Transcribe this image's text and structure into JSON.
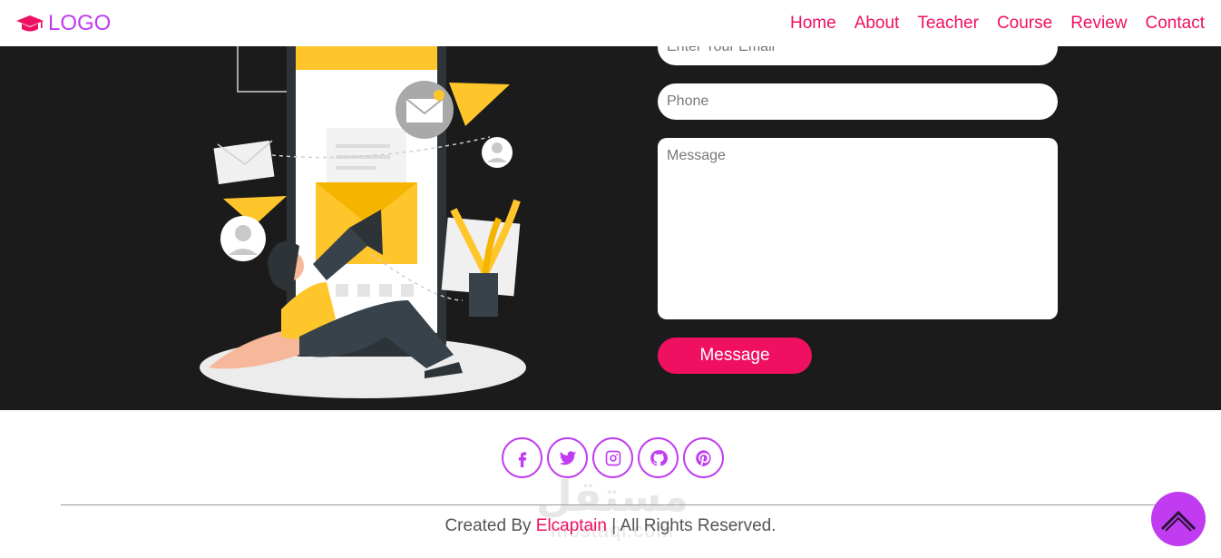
{
  "header": {
    "logo_text": "LOGO",
    "logo_icon": "graduation-cap-icon",
    "nav": [
      {
        "label": "Home"
      },
      {
        "label": "About"
      },
      {
        "label": "Teacher"
      },
      {
        "label": "Course"
      },
      {
        "label": "Review"
      },
      {
        "label": "Contact"
      }
    ]
  },
  "contact": {
    "email_placeholder": "Enter Your Email",
    "phone_placeholder": "Phone",
    "message_placeholder": "Message",
    "submit_label": "Message"
  },
  "footer": {
    "socials": [
      {
        "icon": "facebook-icon"
      },
      {
        "icon": "twitter-icon"
      },
      {
        "icon": "instagram-icon"
      },
      {
        "icon": "github-icon"
      },
      {
        "icon": "pinterest-icon"
      }
    ],
    "credits_prefix": "Created By",
    "credits_brand": "Elcaptain",
    "credits_suffix": "| All Rights Reserved.",
    "watermark_main": "مستقل",
    "watermark_sub": "mostaql.com"
  },
  "colors": {
    "accent_pink": "#ef1062",
    "accent_purple": "#c13cf0",
    "section_dark": "#1c1b1c"
  }
}
